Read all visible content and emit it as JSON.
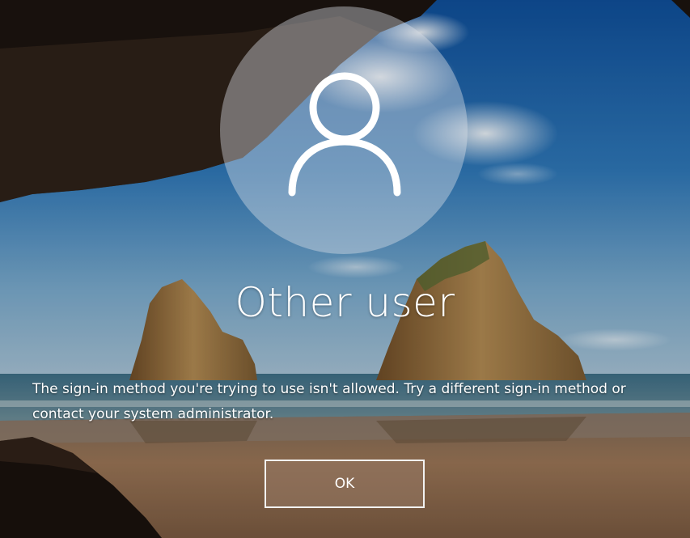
{
  "lock_screen": {
    "user_name": "Other user",
    "message": "The sign-in method you're trying to use isn't allowed. Try a different sign-in method or contact your system administrator.",
    "ok_label": "OK",
    "avatar_icon": "user-silhouette-icon"
  },
  "background": {
    "sky_color": "#2f6fae",
    "sea_color": "#3a6d80",
    "sand_color": "#8a6a4f",
    "cave_color": "#1a120e"
  }
}
